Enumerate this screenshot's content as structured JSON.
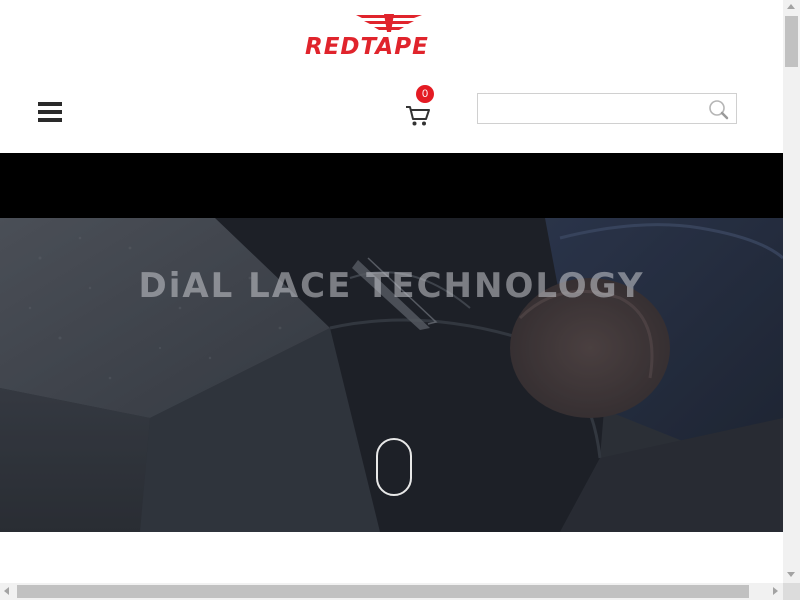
{
  "header": {
    "logo_text": "REDTAPE",
    "cart_count": "0",
    "search_value": ""
  },
  "hero": {
    "title": "DiAL LACE TECHNOLOGY"
  },
  "colors": {
    "brand_red": "#e0242c",
    "badge_red": "#e41b23",
    "band_black": "#000000",
    "hero_dark": "#2c323a"
  },
  "icons": {
    "menu": "hamburger-icon",
    "cart": "cart-icon",
    "search": "search-icon",
    "logo": "wings-logo-icon",
    "scroll": "scroll-mouse-icon"
  }
}
